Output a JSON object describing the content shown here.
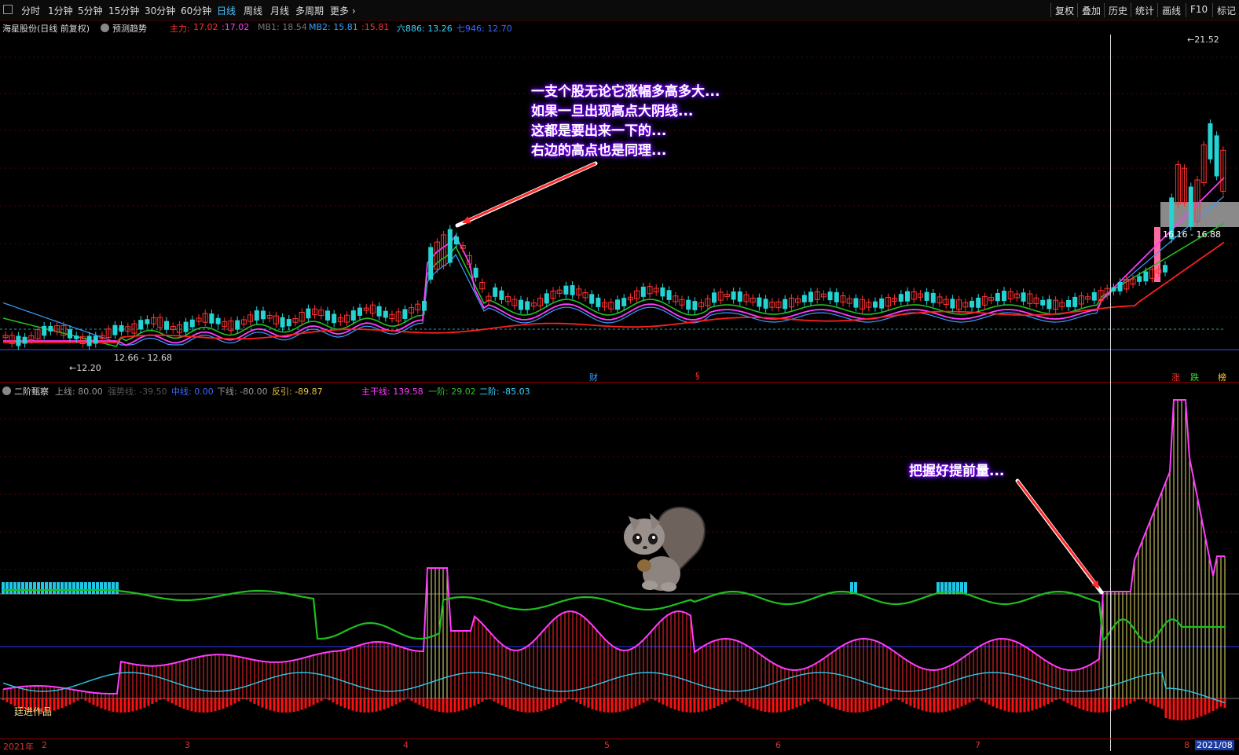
{
  "toolbar": {
    "periods": [
      "分时",
      "1分钟",
      "5分钟",
      "15分钟",
      "30分钟",
      "60分钟",
      "日线",
      "周线",
      "月线",
      "多周期",
      "更多"
    ],
    "active_period": "日线",
    "right_tools": [
      "复权",
      "叠加",
      "历史",
      "统计",
      "画线",
      "F10",
      "标记"
    ]
  },
  "main_info": {
    "stock": "海星股份(日线 前复权)",
    "forecast": "预测趋势",
    "zhuli_label": "主力:",
    "zhuli_v1": "17.02",
    "zhuli_v2": ":17.02",
    "mb1": "MB1: 18.54",
    "mb2_label": "MB2: 15.81",
    "mb2_v": ":15.81",
    "six": "六886: 13.26",
    "seven": "七946: 12.70"
  },
  "price_labels": {
    "high": "21.52",
    "low": "12.20",
    "range1": "12.66 - 12.68",
    "range2": "16.16 - 16.88"
  },
  "event_marks": {
    "cai": "财",
    "s": "§",
    "zhang": "涨",
    "die": "跌",
    "bang": "榜"
  },
  "sub_info": {
    "name": "二阶甄察",
    "upper": "上线: 80.00",
    "strong": "强势线: -39.50",
    "mid": "中线: 0.00",
    "lower": "下线: -80.00",
    "fan": "反引: -89.87",
    "main_line": "主干线: 139.58",
    "first": "一阶: 29.02",
    "second": "二阶: -85.03"
  },
  "annotations": {
    "top": [
      "一支个股无论它涨幅多高多大...",
      "如果一旦出现高点大阴线...",
      "这都是要出来一下的...",
      "右边的高点也是同理..."
    ],
    "bottom": "把握好提前量..."
  },
  "watermark": "廷进作品",
  "x_axis": {
    "year": "2021年",
    "months": [
      "2",
      "3",
      "4",
      "5",
      "6",
      "7",
      "8"
    ],
    "current": "2021/08"
  },
  "colors": {
    "up": "#ff3232",
    "down": "#25d3d3",
    "ma_red": "#ff1f1f",
    "ma_magenta": "#ff3cff",
    "ma_green": "#1fbf1f",
    "ma_blue": "#3a9cff",
    "arrow": "#ff2a2a",
    "annot_glow": "#7a00ff"
  },
  "icons": [
    "chevron-right-icon",
    "toggle-icon",
    "squirrel-sticker"
  ]
}
